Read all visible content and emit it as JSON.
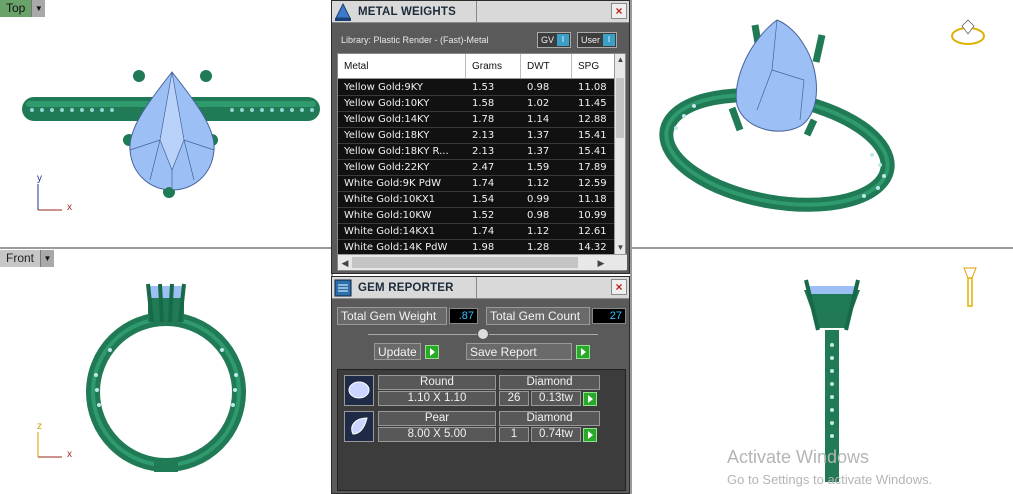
{
  "viewports": {
    "top": {
      "label": "Top"
    },
    "front": {
      "label": "Front"
    }
  },
  "axes": {
    "top_view": {
      "y": "y",
      "x": "x"
    },
    "front_view": {
      "y": "z",
      "x": "x"
    }
  },
  "metal_weights": {
    "title": "METAL WEIGHTS",
    "library": "Library: Plastic Render - (Fast)-Metal",
    "toggle_gv": "GV",
    "toggle_user": "User",
    "columns": [
      "Metal",
      "Grams",
      "DWT",
      "SPG"
    ],
    "rows": [
      [
        "Yellow Gold:9KY",
        "1.53",
        "0.98",
        "11.08"
      ],
      [
        "Yellow Gold:10KY",
        "1.58",
        "1.02",
        "11.45"
      ],
      [
        "Yellow Gold:14KY",
        "1.78",
        "1.14",
        "12.88"
      ],
      [
        "Yellow Gold:18KY",
        "2.13",
        "1.37",
        "15.41"
      ],
      [
        "Yellow Gold:18KY R...",
        "2.13",
        "1.37",
        "15.41"
      ],
      [
        "Yellow Gold:22KY",
        "2.47",
        "1.59",
        "17.89"
      ],
      [
        "White Gold:9K PdW",
        "1.74",
        "1.12",
        "12.59"
      ],
      [
        "White Gold:10KX1",
        "1.54",
        "0.99",
        "11.18"
      ],
      [
        "White Gold:10KW",
        "1.52",
        "0.98",
        "10.99"
      ],
      [
        "White Gold:14KX1",
        "1.74",
        "1.12",
        "12.61"
      ],
      [
        "White Gold:14K PdW",
        "1.98",
        "1.28",
        "14.32"
      ]
    ]
  },
  "gem_reporter": {
    "title": "GEM REPORTER",
    "total_weight_label": "Total Gem Weight",
    "total_weight_value": ".87",
    "total_count_label": "Total Gem Count",
    "total_count_value": "27",
    "update_label": "Update",
    "save_label": "Save Report",
    "gems": [
      {
        "shape": "Round",
        "size": "1.10 X 1.10",
        "type": "Diamond",
        "count": "26",
        "weight": "0.13tw"
      },
      {
        "shape": "Pear",
        "size": "8.00 X 5.00",
        "type": "Diamond",
        "count": "1",
        "weight": "0.74tw"
      }
    ]
  },
  "watermark": {
    "line1": "Activate Windows",
    "line2": "Go to Settings to activate Windows."
  },
  "colors": {
    "metal": "#1f7a55",
    "gem": "#9cc0f5",
    "accent": "#2aa82a",
    "value": "#38c0ff"
  }
}
